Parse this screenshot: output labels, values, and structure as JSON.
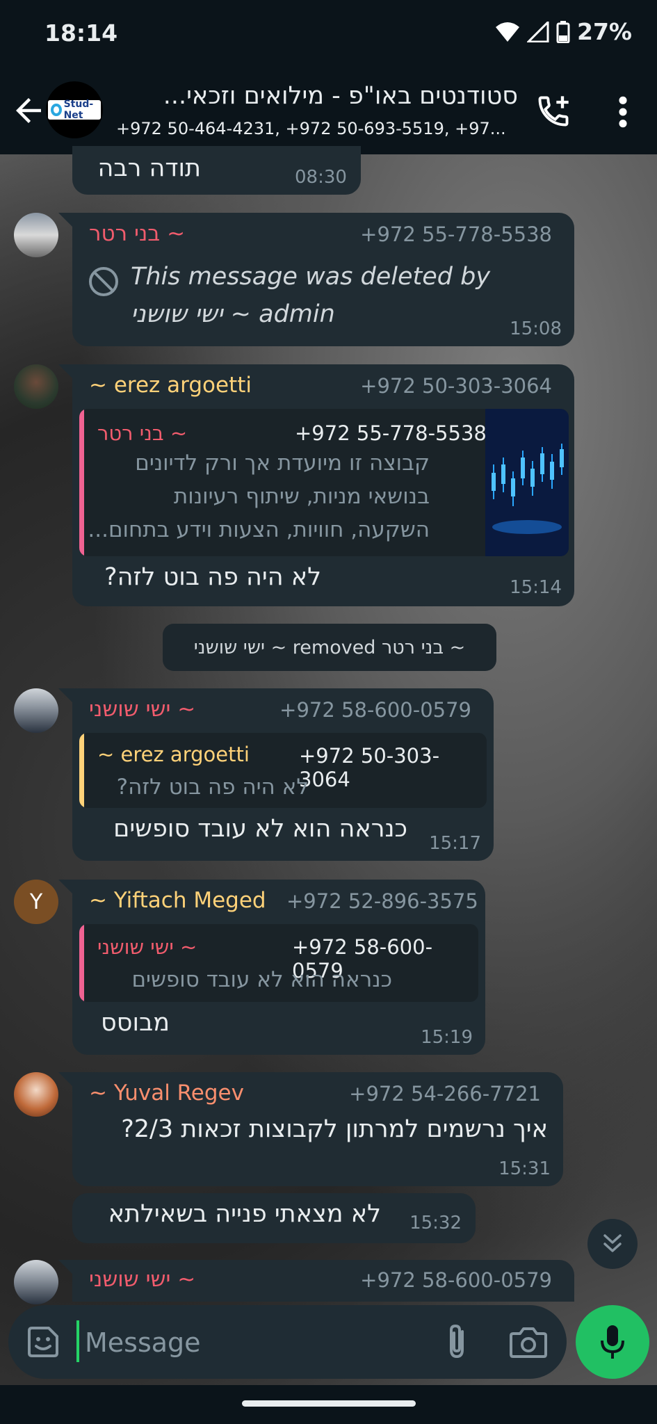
{
  "status": {
    "time": "18:14",
    "battery": "27%"
  },
  "header": {
    "title": "סטודנטים באו\"פ - מילואים וזכאי...",
    "subtitle": "+972 50-464-4231, +972 50-693-5519, +97...",
    "avatar_text": "Stud-Net"
  },
  "messages": [
    {
      "text": "תודה רבה",
      "time": "08:30"
    },
    {
      "sender": "~ בני רטר",
      "phone": "+972 55-778-5538",
      "deleted_line1": "This message was deleted by",
      "deleted_line2": "admin  ~ ישי שושני",
      "time": "15:08"
    },
    {
      "sender": "~ erez argoetti",
      "phone": "+972 50-303-3064",
      "quote": {
        "name": "~ בני רטר",
        "phone": "+972 55-778-5538",
        "lines": [
          "קבוצה זו מיועדת אך ורק לדיונים",
          "בנושאי מניות, שיתוף רעיונות",
          "השקעה, חוויות, הצעות וידע בתחום..."
        ]
      },
      "text": "לא היה פה בוט לזה?",
      "time": "15:14"
    },
    {
      "system": "~ בני רטר removed ~ ישי שושני"
    },
    {
      "sender": "~ ישי שושני",
      "phone": "+972 58-600-0579",
      "quote": {
        "name": "~ erez argoetti",
        "phone": "+972 50-303-3064",
        "lines": [
          "לא היה פה בוט לזה?"
        ]
      },
      "text": "כנראה הוא לא עובד סופשים",
      "time": "15:17"
    },
    {
      "sender": "~ Yiftach Meged",
      "phone": "+972 52-896-3575",
      "avatar_letter": "Y",
      "quote": {
        "name": "~ ישי שושני",
        "phone": "+972 58-600-0579",
        "lines": [
          "כנראה הוא לא עובד סופשים"
        ]
      },
      "text": "מבוסס",
      "time": "15:19"
    },
    {
      "sender": "~ Yuval Regev",
      "phone": "+972 54-266-7721",
      "text": "איך נרשמים למרתון לקבוצות זכאות 2/3?",
      "time": "15:31"
    },
    {
      "text": "לא מצאתי פנייה בשאילתא",
      "time": "15:32"
    },
    {
      "sender": "~ ישי שושני",
      "phone": "+972 58-600-0579"
    }
  ],
  "input": {
    "placeholder": "Message"
  },
  "colors": {
    "bubble": "#202c33",
    "pink_name": "#f15c6d",
    "yellow_name": "#ffd279",
    "orange_name": "#fa8f6e",
    "quote_pink_bar": "#f06292",
    "quote_yellow_bar": "#ffd279",
    "mic_green": "#21c063"
  },
  "icons": [
    "back-arrow-icon",
    "add-call-icon",
    "more-vert-icon",
    "block-icon",
    "chevron-double-down-icon",
    "sticker-icon",
    "attach-icon",
    "camera-icon",
    "mic-icon"
  ]
}
